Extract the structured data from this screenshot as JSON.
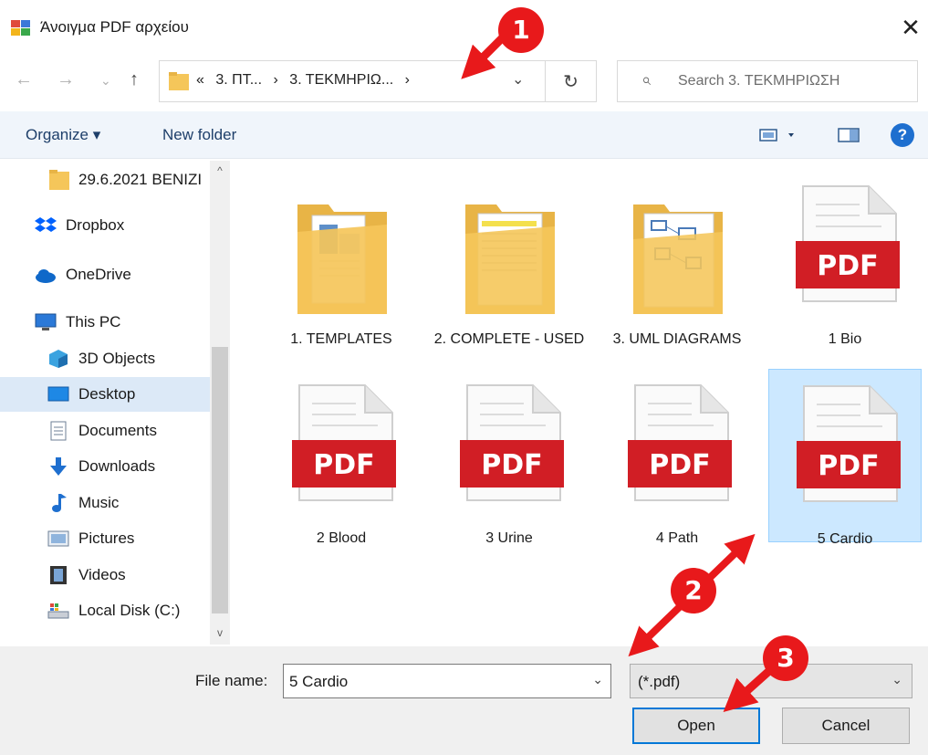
{
  "window": {
    "title": "Άνοιγμα PDF αρχείου",
    "close_glyph": "✕"
  },
  "nav": {
    "back_glyph": "←",
    "forward_glyph": "→",
    "recent_glyph": "⌄",
    "up_glyph": "↑",
    "breadcrumb_prefix": "«",
    "breadcrumbs": [
      "3. ΠΤ...",
      "3. ΤΕΚΜΗΡΙΩ..."
    ],
    "crumb_separator": "›",
    "dropdown_glyph": "⌄",
    "refresh_glyph": "↻",
    "search_placeholder": "Search 3. ΤΕΚΜΗΡΙΩΣΗ"
  },
  "toolbar": {
    "organize_label": "Organize ▾",
    "new_folder_label": "New folder",
    "help_glyph": "?"
  },
  "sidebar": {
    "items": [
      {
        "label": "29.6.2021 BENIZI",
        "icon": "folder-icon"
      },
      {
        "label": "Dropbox",
        "icon": "dropbox-icon"
      },
      {
        "label": "OneDrive",
        "icon": "onedrive-icon"
      },
      {
        "label": "This PC",
        "icon": "this-pc-icon"
      },
      {
        "label": "3D Objects",
        "icon": "3d-objects-icon"
      },
      {
        "label": "Desktop",
        "icon": "desktop-icon",
        "selected": true
      },
      {
        "label": "Documents",
        "icon": "documents-icon"
      },
      {
        "label": "Downloads",
        "icon": "downloads-icon"
      },
      {
        "label": "Music",
        "icon": "music-icon"
      },
      {
        "label": "Pictures",
        "icon": "pictures-icon"
      },
      {
        "label": "Videos",
        "icon": "videos-icon"
      },
      {
        "label": "Local Disk (C:)",
        "icon": "local-disk-icon"
      }
    ],
    "scroll_up_glyph": "^",
    "scroll_down_glyph": "v"
  },
  "files": [
    {
      "name": "1. TEMPLATES",
      "type": "folder"
    },
    {
      "name": "2. COMPLETE - USED",
      "type": "folder"
    },
    {
      "name": "3. UML DIAGRAMS",
      "type": "folder"
    },
    {
      "name": "1 Bio",
      "type": "pdf"
    },
    {
      "name": "2 Blood",
      "type": "pdf"
    },
    {
      "name": "3 Urine",
      "type": "pdf"
    },
    {
      "name": "4 Path",
      "type": "pdf"
    },
    {
      "name": "5 Cardio",
      "type": "pdf",
      "selected": true
    }
  ],
  "pdf_badge_text": "PDF",
  "bottom": {
    "file_name_label": "File name:",
    "file_name_value": "5 Cardio",
    "filter_value": "(*.pdf)",
    "open_label": "Open",
    "cancel_label": "Cancel"
  },
  "annotations": [
    "1",
    "2",
    "3"
  ],
  "colors": {
    "annotation_red": "#e8191b",
    "selection": "#cce8ff",
    "pdf_red": "#d11e25",
    "folder": "#f5c65a"
  }
}
